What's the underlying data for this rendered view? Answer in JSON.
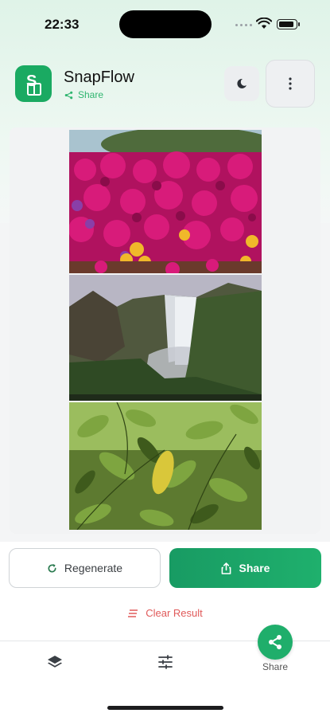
{
  "status_bar": {
    "time": "22:33"
  },
  "header": {
    "app_name": "SnapFlow",
    "subtitle": "Share",
    "app_icon": "snapflow-logo-icon",
    "theme_icon": "theme-toggle-icon",
    "more_icon": "more-vertical-icon"
  },
  "result": {
    "images": [
      {
        "subject": "pink-flowers"
      },
      {
        "subject": "waterfall"
      },
      {
        "subject": "green-leaves"
      }
    ]
  },
  "actions": {
    "regenerate_label": "Regenerate",
    "regenerate_icon": "refresh-icon",
    "share_label": "Share",
    "share_icon": "share-upload-icon",
    "clear_label": "Clear Result",
    "clear_icon": "clear-icon"
  },
  "nav": {
    "items": [
      {
        "icon": "layers-icon",
        "label": ""
      },
      {
        "icon": "sliders-icon",
        "label": ""
      },
      {
        "icon": "share-icon",
        "label": "Share",
        "active": true
      }
    ]
  },
  "colors": {
    "accent": "#1fae6b",
    "danger": "#e05a5a",
    "brand": "#1aaa62"
  }
}
